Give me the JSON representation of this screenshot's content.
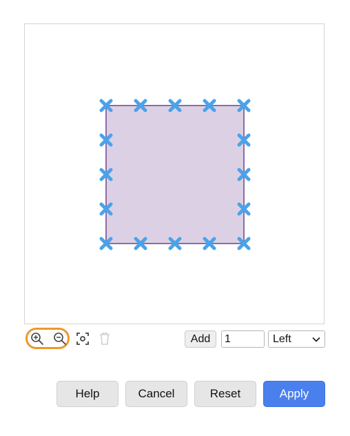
{
  "editor": {
    "shape_fill": "#dcd1e4",
    "shape_stroke": "#8e6ba8",
    "handle_color": "#4aa3ea",
    "handle_icon": "x-handle-icon"
  },
  "toolbar": {
    "zoom_in_icon": "zoom-in-icon",
    "zoom_out_icon": "zoom-out-icon",
    "fit_icon": "fit-screen-icon",
    "delete_icon": "trash-icon",
    "highlight_color": "#f0962b",
    "add_label": "Add",
    "count_value": "1",
    "side_value": "Left"
  },
  "footer": {
    "help_label": "Help",
    "cancel_label": "Cancel",
    "reset_label": "Reset",
    "apply_label": "Apply",
    "apply_color": "#4a7fee"
  }
}
